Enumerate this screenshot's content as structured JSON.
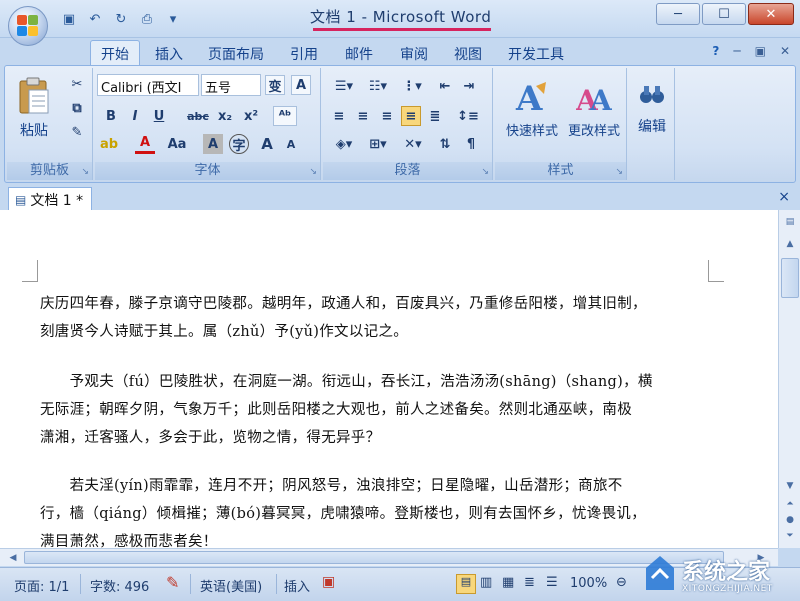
{
  "window": {
    "title": "文档 1 - Microsoft Word",
    "controls": {
      "minimize": "─",
      "maximize": "☐",
      "close": "✕"
    }
  },
  "quick_access": [
    {
      "icon": "save-icon",
      "glyph": "▣"
    },
    {
      "icon": "undo-icon",
      "glyph": "↶"
    },
    {
      "icon": "redo-icon",
      "glyph": "↻"
    },
    {
      "icon": "print-preview-icon",
      "glyph": "⎙"
    },
    {
      "icon": "customize-icon",
      "glyph": "▾"
    }
  ],
  "tabs": [
    "开始",
    "插入",
    "页面布局",
    "引用",
    "邮件",
    "审阅",
    "视图",
    "开发工具"
  ],
  "tabrow_right": {
    "help": "?",
    "minimize": "─",
    "restore": "▣",
    "close": "✕"
  },
  "ribbon": {
    "clipboard": {
      "paste_label": "粘贴",
      "group_label": "剪贴板"
    },
    "font": {
      "font_name": "Calibri (西文I",
      "font_size": "五号",
      "group_label": "字体",
      "row2": [
        "B",
        "I",
        "U",
        "abc",
        "x₂",
        "x²"
      ],
      "row3": [
        "A",
        "Aa",
        "A",
        "字",
        "A",
        "A"
      ]
    },
    "paragraph": {
      "group_label": "段落"
    },
    "styles": {
      "quick_styles": "快速样式",
      "change_styles": "更改样式",
      "group_label": "样式"
    },
    "editing": {
      "label": "编辑"
    }
  },
  "document_tab": {
    "name": "文档 1 *",
    "close": "×"
  },
  "document": {
    "paragraphs": [
      [
        "庆历四年春，滕子京谪守巴陵郡。越明年，政通人和，百废具兴，乃重修岳阳楼，增其旧制，",
        "刻唐贤今人诗赋于其上。属（zhǔ）予(yǔ)作文以记之。"
      ],
      [
        "　　予观夫（fú）巴陵胜状，在洞庭一湖。衔远山，吞长江，浩浩汤汤(shāng)（shang)，横",
        "无际涯；朝晖夕阴，气象万千；此则岳阳楼之大观也，前人之述备矣。然则北通巫峡，南极",
        "潇湘，迁客骚人，多会于此，览物之情，得无异乎？"
      ],
      [
        "　　若夫淫(yín)雨霏霏，连月不开；阴风怒号，浊浪排空；日星隐曜，山岳潜形；商旅不",
        "行，樯（qiáng）倾楫摧；薄(bó)暮冥冥，虎啸猿啼。登斯楼也，则有去国怀乡，忧谗畏讥，",
        "满目萧然，感极而悲者矣！"
      ]
    ]
  },
  "statusbar": {
    "page": "页面: 1/1",
    "words": "字数: 496",
    "language": "英语(美国)",
    "insert": "插入",
    "zoom": "100%"
  },
  "watermark": {
    "text": "系统之家",
    "url": "XITONGZHIJIA.NET"
  }
}
